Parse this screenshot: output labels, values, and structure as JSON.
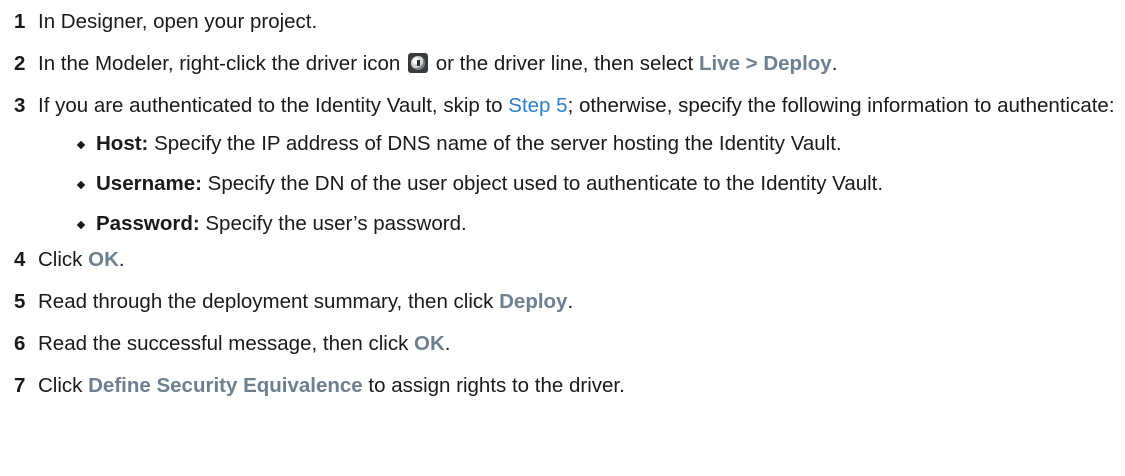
{
  "steps": [
    {
      "num": "1",
      "text": "In Designer, open your project."
    },
    {
      "num": "2",
      "pre": "In the Modeler, right-click the driver icon",
      "mid": "or the driver line, then select",
      "ui": "Live > Deploy",
      "post": ".",
      "icon": "driver-icon"
    },
    {
      "num": "3",
      "pre": "If you are authenticated to the Identity Vault, skip to",
      "link": "Step 5",
      "post": "; otherwise, specify the following information to authenticate:",
      "bullets": [
        {
          "term": "Host:",
          "text": "Specify the IP address of DNS name of the server hosting the Identity Vault."
        },
        {
          "term": "Username:",
          "text": "Specify the DN of the user object used to authenticate to the Identity Vault."
        },
        {
          "term": "Password:",
          "text": "Specify the user’s password."
        }
      ]
    },
    {
      "num": "4",
      "pre": "Click",
      "ui": "OK",
      "post": "."
    },
    {
      "num": "5",
      "pre": "Read through the deployment summary, then click",
      "ui": "Deploy",
      "post": "."
    },
    {
      "num": "6",
      "pre": "Read the successful message, then click",
      "ui": "OK",
      "post": "."
    },
    {
      "num": "7",
      "pre": "Click",
      "ui": "Define Security Equivalence",
      "post": "to assign rights to the driver."
    }
  ],
  "colors": {
    "ui_label": "#6e7f8f",
    "link": "#2f80c8",
    "text": "#1a1a1a"
  }
}
